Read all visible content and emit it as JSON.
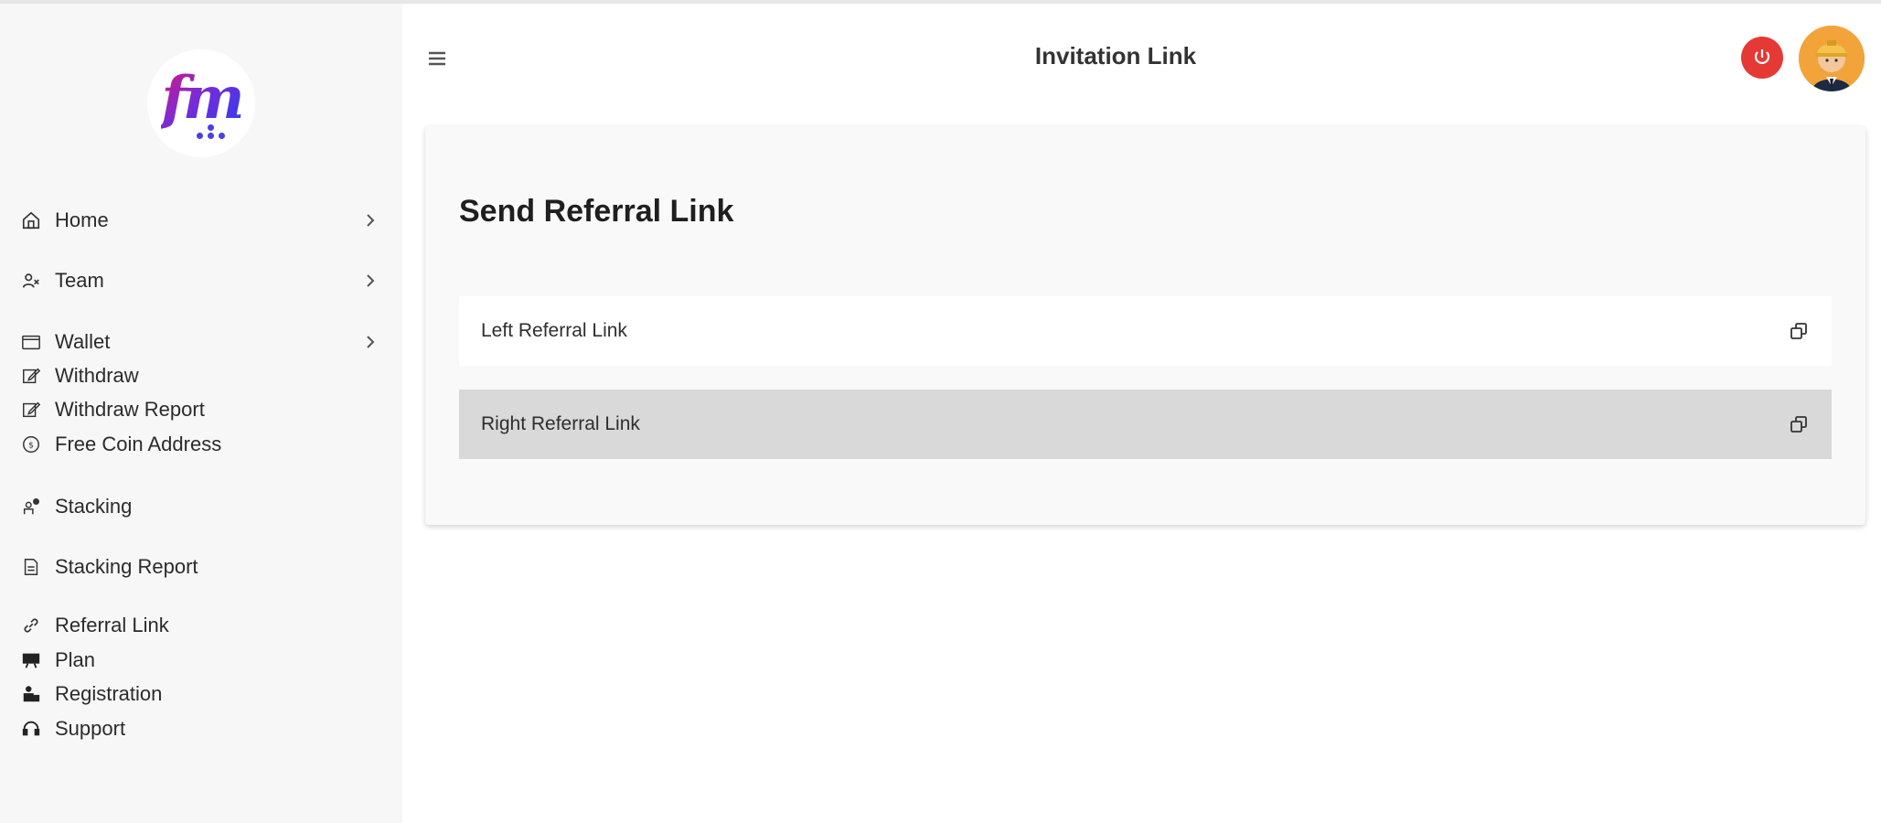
{
  "header": {
    "title": "Invitation Link",
    "menu_icon": "hamburger-icon",
    "power_icon": "power-icon",
    "power_color": "#e53935",
    "avatar_bg": "#f2a33a"
  },
  "logo": {
    "text": "fm"
  },
  "sidebar": {
    "items": [
      {
        "label": "Home",
        "icon": "home-icon",
        "has_chevron": true
      },
      {
        "label": "Team",
        "icon": "team-icon",
        "has_chevron": true
      },
      {
        "label": "Wallet",
        "icon": "wallet-icon",
        "has_chevron": true
      },
      {
        "label": "Withdraw",
        "icon": "edit-icon",
        "has_chevron": false
      },
      {
        "label": "Withdraw Report",
        "icon": "edit-icon",
        "has_chevron": false
      },
      {
        "label": "Free Coin Address",
        "icon": "coin-icon",
        "has_chevron": false
      },
      {
        "label": "Stacking",
        "icon": "stacking-icon",
        "has_chevron": false
      },
      {
        "label": "Stacking Report",
        "icon": "report-icon",
        "has_chevron": false
      },
      {
        "label": "Referral Link",
        "icon": "link-icon",
        "has_chevron": false
      },
      {
        "label": "Plan",
        "icon": "plan-icon",
        "has_chevron": false
      },
      {
        "label": "Registration",
        "icon": "registration-icon",
        "has_chevron": false
      },
      {
        "label": "Support",
        "icon": "headset-icon",
        "has_chevron": false
      }
    ]
  },
  "main": {
    "heading": "Send Referral Link",
    "links": [
      {
        "label": "Left Referral Link",
        "icon": "copy-icon"
      },
      {
        "label": "Right Referral Link",
        "icon": "copy-icon"
      }
    ]
  }
}
